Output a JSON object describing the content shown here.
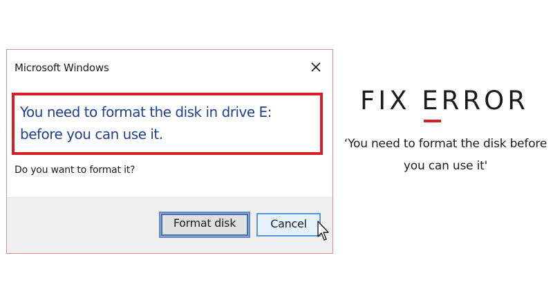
{
  "dialog": {
    "title": "Microsoft Windows",
    "close_icon": "close-icon",
    "message": "You need to format the disk in drive E: before you can use it.",
    "question": "Do you want to format it?",
    "buttons": {
      "format_label": "Format disk",
      "cancel_label": "Cancel"
    },
    "colors": {
      "message_text": "#1d3f8f",
      "highlight_border": "#d81f26",
      "dialog_border": "#e38a8f",
      "button_area_bg": "#f0f0f0"
    }
  },
  "cursor": {
    "icon": "mouse-pointer-icon"
  },
  "caption": {
    "heading": "FIX ERROR",
    "subtitle": "‘You need to format the disk before you can use it'",
    "accent_color": "#d81f26"
  }
}
